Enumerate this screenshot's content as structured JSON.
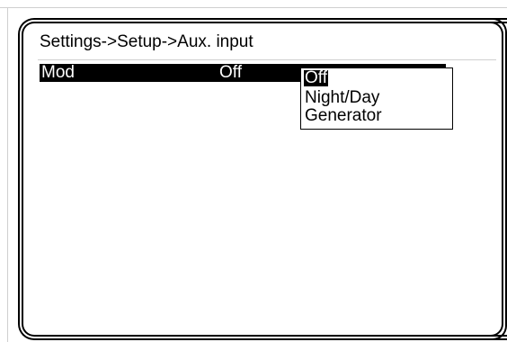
{
  "screen": {
    "title": "Settings->Setup->Aux. input"
  },
  "setting": {
    "label": "Mod",
    "value": "Off"
  },
  "dropdown": {
    "options": [
      "Off",
      "Night/Day",
      "Generator"
    ],
    "selected": "Off"
  }
}
